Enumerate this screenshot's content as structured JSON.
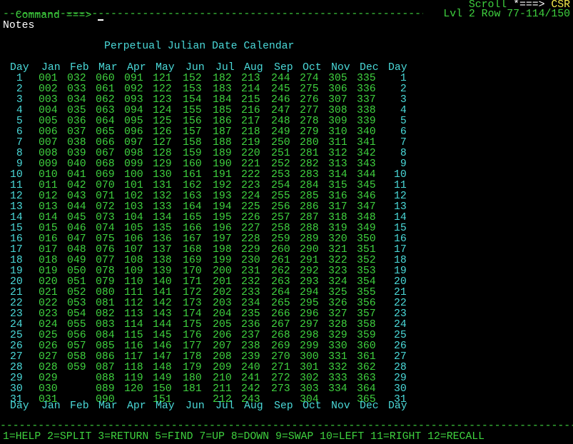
{
  "header": {
    "command_label": "Command ===>",
    "scroll_label": "Scroll ",
    "scroll_arrow": "*===>",
    "scroll_value": "CSR",
    "dashes_top": "--------------------------------------------------------------------------",
    "level_row": "Lvl 2 Row 77-114/150"
  },
  "notes_label": "Notes",
  "calendar": {
    "title": "Perpetual Julian Date Calendar",
    "col_header": [
      "Day",
      "Jan",
      "Feb",
      "Mar",
      "Apr",
      "May",
      "Jun",
      "Jul",
      "Aug",
      "Sep",
      "Oct",
      "Nov",
      "Dec",
      "Day"
    ],
    "rows": [
      [
        " 1",
        "001",
        "032",
        "060",
        "091",
        "121",
        "152",
        "182",
        "213",
        "244",
        "274",
        "305",
        "335",
        " 1"
      ],
      [
        " 2",
        "002",
        "033",
        "061",
        "092",
        "122",
        "153",
        "183",
        "214",
        "245",
        "275",
        "306",
        "336",
        " 2"
      ],
      [
        " 3",
        "003",
        "034",
        "062",
        "093",
        "123",
        "154",
        "184",
        "215",
        "246",
        "276",
        "307",
        "337",
        " 3"
      ],
      [
        " 4",
        "004",
        "035",
        "063",
        "094",
        "124",
        "155",
        "185",
        "216",
        "247",
        "277",
        "308",
        "338",
        " 4"
      ],
      [
        " 5",
        "005",
        "036",
        "064",
        "095",
        "125",
        "156",
        "186",
        "217",
        "248",
        "278",
        "309",
        "339",
        " 5"
      ],
      [
        " 6",
        "006",
        "037",
        "065",
        "096",
        "126",
        "157",
        "187",
        "218",
        "249",
        "279",
        "310",
        "340",
        " 6"
      ],
      [
        " 7",
        "007",
        "038",
        "066",
        "097",
        "127",
        "158",
        "188",
        "219",
        "250",
        "280",
        "311",
        "341",
        " 7"
      ],
      [
        " 8",
        "008",
        "039",
        "067",
        "098",
        "128",
        "159",
        "189",
        "220",
        "251",
        "281",
        "312",
        "342",
        " 8"
      ],
      [
        " 9",
        "009",
        "040",
        "068",
        "099",
        "129",
        "160",
        "190",
        "221",
        "252",
        "282",
        "313",
        "343",
        " 9"
      ],
      [
        "10",
        "010",
        "041",
        "069",
        "100",
        "130",
        "161",
        "191",
        "222",
        "253",
        "283",
        "314",
        "344",
        "10"
      ],
      [
        "11",
        "011",
        "042",
        "070",
        "101",
        "131",
        "162",
        "192",
        "223",
        "254",
        "284",
        "315",
        "345",
        "11"
      ],
      [
        "12",
        "012",
        "043",
        "071",
        "102",
        "132",
        "163",
        "193",
        "224",
        "255",
        "285",
        "316",
        "346",
        "12"
      ],
      [
        "13",
        "013",
        "044",
        "072",
        "103",
        "133",
        "164",
        "194",
        "225",
        "256",
        "286",
        "317",
        "347",
        "13"
      ],
      [
        "14",
        "014",
        "045",
        "073",
        "104",
        "134",
        "165",
        "195",
        "226",
        "257",
        "287",
        "318",
        "348",
        "14"
      ],
      [
        "15",
        "015",
        "046",
        "074",
        "105",
        "135",
        "166",
        "196",
        "227",
        "258",
        "288",
        "319",
        "349",
        "15"
      ],
      [
        "16",
        "016",
        "047",
        "075",
        "106",
        "136",
        "167",
        "197",
        "228",
        "259",
        "289",
        "320",
        "350",
        "16"
      ],
      [
        "17",
        "017",
        "048",
        "076",
        "107",
        "137",
        "168",
        "198",
        "229",
        "260",
        "290",
        "321",
        "351",
        "17"
      ],
      [
        "18",
        "018",
        "049",
        "077",
        "108",
        "138",
        "169",
        "199",
        "230",
        "261",
        "291",
        "322",
        "352",
        "18"
      ],
      [
        "19",
        "019",
        "050",
        "078",
        "109",
        "139",
        "170",
        "200",
        "231",
        "262",
        "292",
        "323",
        "353",
        "19"
      ],
      [
        "20",
        "020",
        "051",
        "079",
        "110",
        "140",
        "171",
        "201",
        "232",
        "263",
        "293",
        "324",
        "354",
        "20"
      ],
      [
        "21",
        "021",
        "052",
        "080",
        "111",
        "141",
        "172",
        "202",
        "233",
        "264",
        "294",
        "325",
        "355",
        "21"
      ],
      [
        "22",
        "022",
        "053",
        "081",
        "112",
        "142",
        "173",
        "203",
        "234",
        "265",
        "295",
        "326",
        "356",
        "22"
      ],
      [
        "23",
        "023",
        "054",
        "082",
        "113",
        "143",
        "174",
        "204",
        "235",
        "266",
        "296",
        "327",
        "357",
        "23"
      ],
      [
        "24",
        "024",
        "055",
        "083",
        "114",
        "144",
        "175",
        "205",
        "236",
        "267",
        "297",
        "328",
        "358",
        "24"
      ],
      [
        "25",
        "025",
        "056",
        "084",
        "115",
        "145",
        "176",
        "206",
        "237",
        "268",
        "298",
        "329",
        "359",
        "25"
      ],
      [
        "26",
        "026",
        "057",
        "085",
        "116",
        "146",
        "177",
        "207",
        "238",
        "269",
        "299",
        "330",
        "360",
        "26"
      ],
      [
        "27",
        "027",
        "058",
        "086",
        "117",
        "147",
        "178",
        "208",
        "239",
        "270",
        "300",
        "331",
        "361",
        "27"
      ],
      [
        "28",
        "028",
        "059",
        "087",
        "118",
        "148",
        "179",
        "209",
        "240",
        "271",
        "301",
        "332",
        "362",
        "28"
      ],
      [
        "29",
        "029",
        "",
        "088",
        "119",
        "149",
        "180",
        "210",
        "241",
        "272",
        "302",
        "333",
        "363",
        "29"
      ],
      [
        "30",
        "030",
        "",
        "089",
        "120",
        "150",
        "181",
        "211",
        "242",
        "273",
        "303",
        "334",
        "364",
        "30"
      ],
      [
        "31",
        "031",
        "",
        "090",
        "",
        "151",
        "",
        "212",
        "243",
        "",
        "304",
        "",
        "365",
        "31"
      ]
    ]
  },
  "footer": {
    "dashes_bottom": "------------------------------------------------------------------------------------------------",
    "pf_keys": [
      {
        "key": "1",
        "label": "HELP"
      },
      {
        "key": "2",
        "label": "SPLIT"
      },
      {
        "key": "3",
        "label": "RETURN"
      },
      {
        "key": "5",
        "label": "FIND"
      },
      {
        "key": "7",
        "label": "UP"
      },
      {
        "key": "8",
        "label": "DOWN"
      },
      {
        "key": "9",
        "label": "SWAP"
      },
      {
        "key": "10",
        "label": "LEFT"
      },
      {
        "key": "11",
        "label": "RIGHT"
      },
      {
        "key": "12",
        "label": "RECALL"
      }
    ]
  },
  "colors": {
    "background": "#000000",
    "green": "#3fd23f",
    "cyan": "#4ad9d9",
    "yellow": "#f5e94b",
    "white": "#ffffff"
  }
}
